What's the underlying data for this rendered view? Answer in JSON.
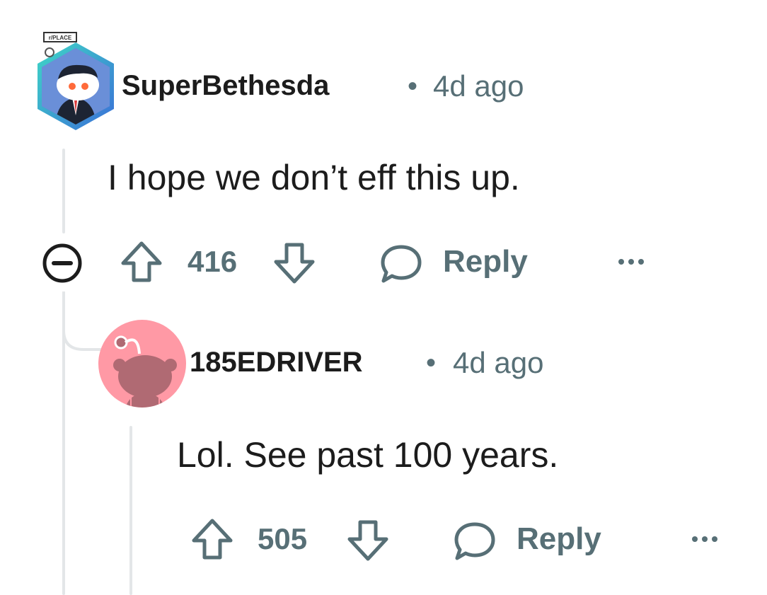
{
  "comment": {
    "username": "SuperBethesda",
    "separator": "•",
    "time": "4d ago",
    "body": "I hope we don’t eff this up.",
    "score": "416",
    "reply_label": "Reply",
    "more_label": "•••",
    "avatar_badge": "r/PLACE"
  },
  "reply": {
    "username": "185EDRIVER",
    "separator": "•",
    "time": "4d ago",
    "body": "Lol. See past 100 years.",
    "score": "505",
    "reply_label": "Reply",
    "more_label": "•••"
  },
  "colors": {
    "meta_gray": "#576f76",
    "thread_line": "#e3e6e8",
    "reply_avatar_bg": "#ff99a5",
    "reply_avatar_fg": "#b06a73",
    "hex_teal": "#3fd8c6",
    "hex_blue": "#3a6fd8"
  }
}
